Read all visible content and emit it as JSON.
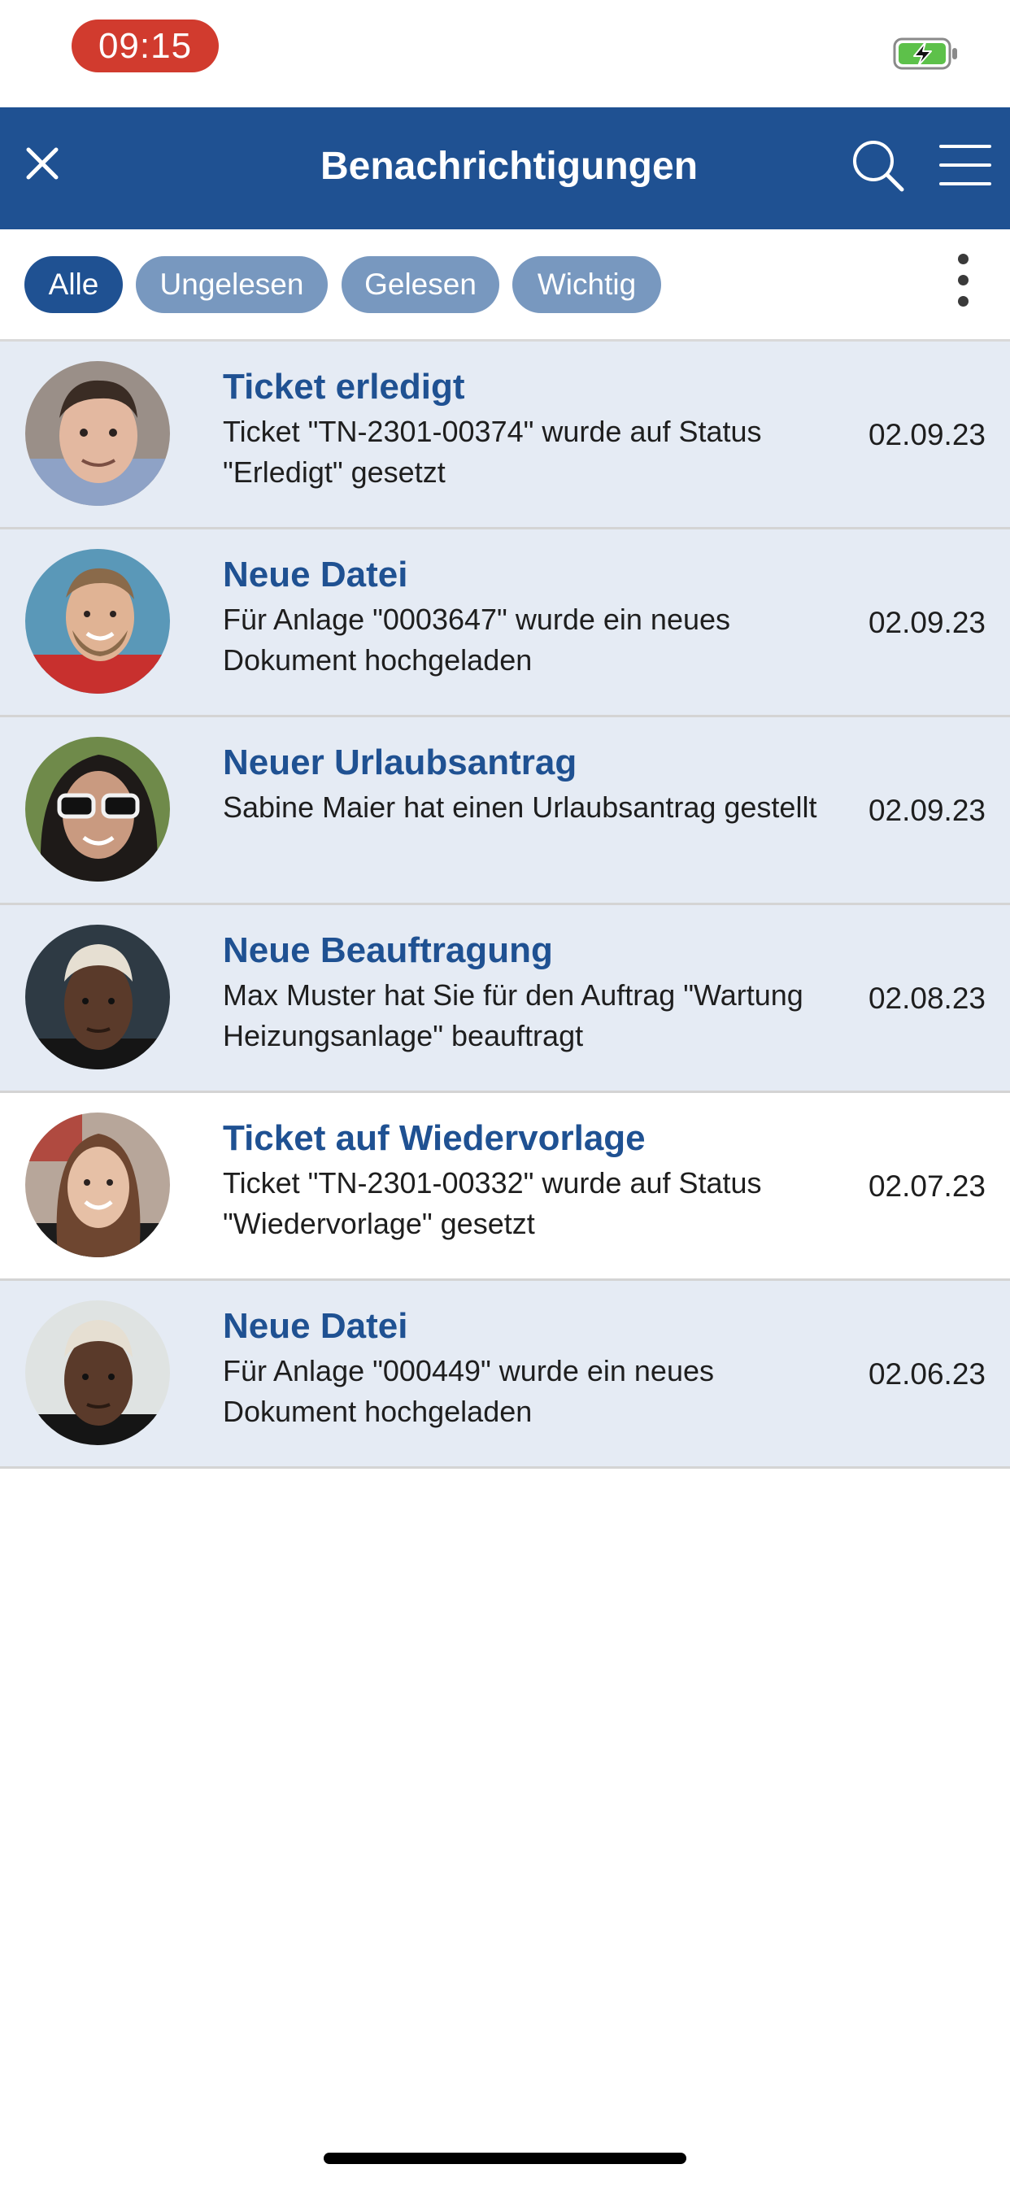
{
  "status_bar": {
    "time": "09:15",
    "battery_icon": "battery-charging-icon",
    "battery_color": "#5dc14a"
  },
  "app_bar": {
    "title": "Benachrichtigungen",
    "close_icon": "close-icon",
    "search_icon": "search-icon",
    "menu_icon": "hamburger-menu-icon",
    "background": "#1f5192"
  },
  "filters": {
    "chips": [
      {
        "label": "Alle",
        "active": true
      },
      {
        "label": "Ungelesen",
        "active": false
      },
      {
        "label": "Gelesen",
        "active": false
      },
      {
        "label": "Wichtig",
        "active": false
      }
    ],
    "more_icon": "more-vertical-icon"
  },
  "notifications": [
    {
      "title": "Ticket erledigt",
      "text": "Ticket \"TN-2301-00374\" wurde auf Status \"Erledigt\" gesetzt",
      "date": "02.09.23",
      "read": false
    },
    {
      "title": "Neue Datei",
      "text": "Für Anlage \"0003647\" wurde ein neues Dokument hochgeladen",
      "date": "02.09.23",
      "read": false
    },
    {
      "title": "Neuer Urlaubsantrag",
      "text": "Sabine Maier hat einen Urlaubsantrag gestellt",
      "date": "02.09.23",
      "read": false
    },
    {
      "title": "Neue Beauftragung",
      "text": "Max Muster hat Sie für den Auftrag \"Wartung Heizungsanlage\" beauftragt",
      "date": "02.08.23",
      "read": false
    },
    {
      "title": "Ticket auf Wiedervorlage",
      "text": "Ticket \"TN-2301-00332\" wurde auf Status \"Wiedervorlage\" gesetzt",
      "date": "02.07.23",
      "read": true
    },
    {
      "title": "Neue Datei",
      "text": "Für Anlage \"000449\" wurde ein neues Dokument hochgeladen",
      "date": "02.06.23",
      "read": false
    }
  ],
  "colors": {
    "accent": "#1f5192",
    "chip_inactive": "#7898bf",
    "unread_row": "#e5ebf4",
    "time_pill": "#d13b2e"
  }
}
